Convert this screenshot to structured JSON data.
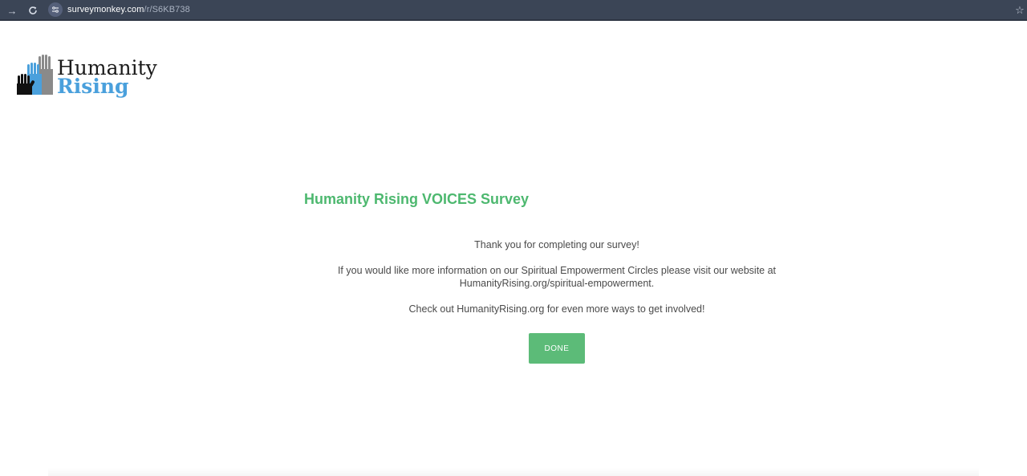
{
  "browser": {
    "url_host": "surveymonkey.com",
    "url_path": "/r/S6KB738",
    "icons": [
      "forward-icon",
      "reload-icon",
      "site-info-icon",
      "bookmark-star-icon"
    ]
  },
  "logo": {
    "line1": "Humanity",
    "line2": "Rising",
    "colors": {
      "black": "#1a1a1a",
      "blue": "#4aa0dc",
      "gray": "#8a8a8a"
    }
  },
  "survey": {
    "title": "Humanity Rising VOICES Survey",
    "thank_you": "Thank you for completing our survey!",
    "info_line1": "If you would like more information on our Spiritual Empowerment Circles please visit our website at",
    "info_line2": "HumanityRising.org/spiritual-empowerment.",
    "check_out": "Check out HumanityRising.org for even more ways to get involved!",
    "done_label": "DONE"
  },
  "colors": {
    "accent_green": "#5cbb78",
    "title_green": "#4db86f",
    "browser_bar": "#3b4556"
  }
}
